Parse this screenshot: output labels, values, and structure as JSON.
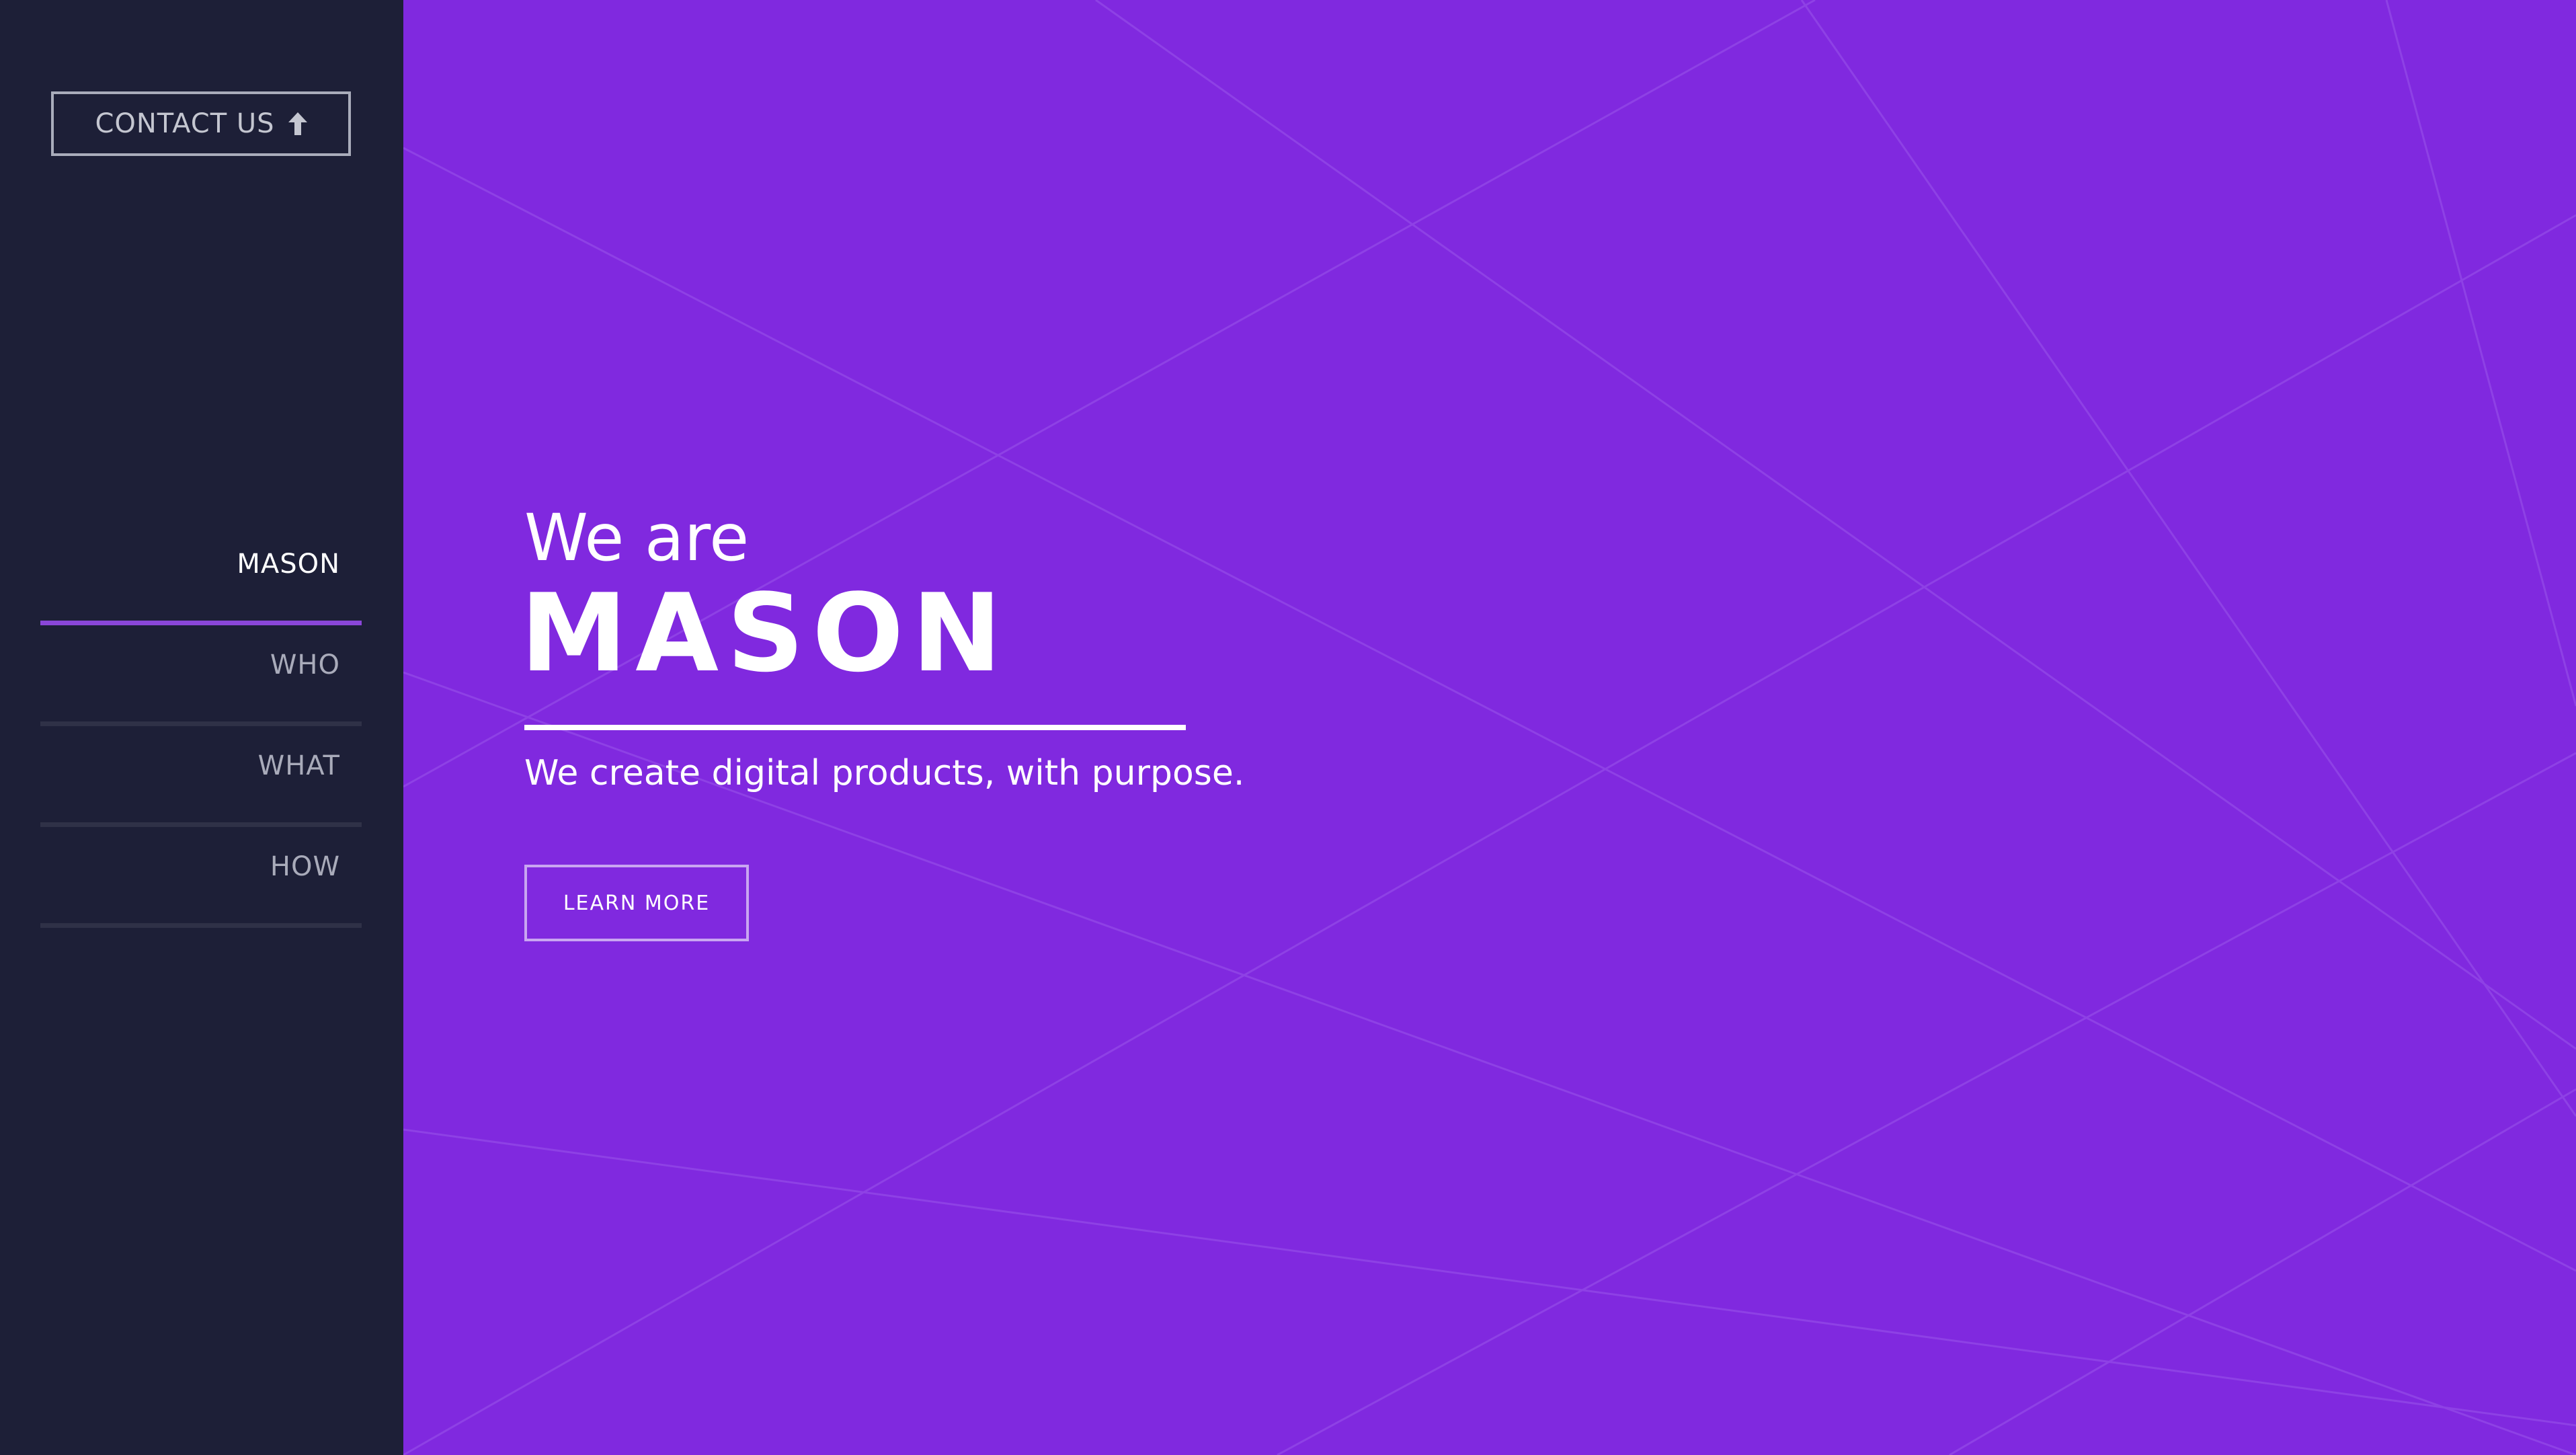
{
  "colors": {
    "sidebar_bg": "#1d1f37",
    "hero_bg": "#8029df",
    "accent": "#8a46d8"
  },
  "sidebar": {
    "contact_label": "CONTACT US",
    "contact_icon": "arrow-up-icon",
    "nav": [
      {
        "label": "MASON",
        "active": true
      },
      {
        "label": "WHO",
        "active": false
      },
      {
        "label": "WHAT",
        "active": false
      },
      {
        "label": "HOW",
        "active": false
      }
    ]
  },
  "hero": {
    "kicker": "We are",
    "title": "MASON",
    "tagline": "We create digital products, with purpose.",
    "cta_label": "LEARN MORE"
  }
}
